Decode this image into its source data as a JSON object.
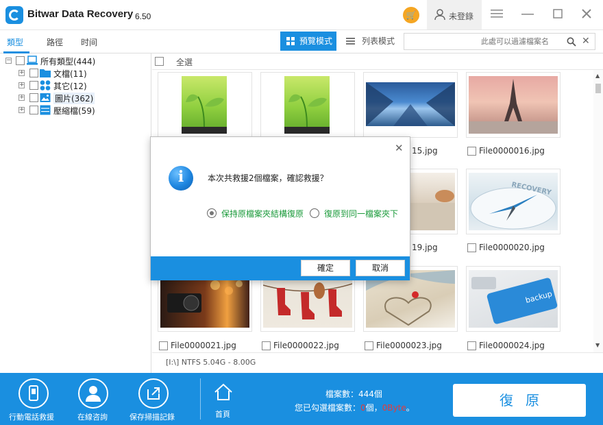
{
  "app": {
    "title": "Bitwar Data Recovery",
    "version": "6.50",
    "user_label": "未登錄",
    "icons": [
      "cart-icon",
      "user-icon",
      "menu-icon",
      "minimize-icon",
      "maximize-icon",
      "close-icon"
    ]
  },
  "tabs": [
    {
      "label": "類型",
      "active": true
    },
    {
      "label": "路徑",
      "active": false
    },
    {
      "label": "时间",
      "active": false
    }
  ],
  "view": {
    "preview_label": "預覽模式",
    "list_label": "列表模式"
  },
  "search": {
    "placeholder": "此處可以過濾檔案名"
  },
  "tree": {
    "root": "所有類型(444)",
    "items": [
      {
        "label": "文檔(11)",
        "icon": "folder-icon"
      },
      {
        "label": "其它(12)",
        "icon": "apps-icon"
      },
      {
        "label": "圖片(362)",
        "icon": "picture-icon"
      },
      {
        "label": "壓縮檔(59)",
        "icon": "archive-icon"
      }
    ]
  },
  "content": {
    "select_all": "全選",
    "files": [
      {
        "name": "",
        "image": "sprout"
      },
      {
        "name": "",
        "image": "sprout"
      },
      {
        "name": "15.jpg",
        "image": "sky"
      },
      {
        "name": "File0000016.jpg",
        "image": "paris"
      },
      {
        "name": "19.jpg",
        "image": "cat"
      },
      {
        "name": "File0000020.jpg",
        "image": "compass"
      },
      {
        "name": "File0000021.jpg",
        "image": "camera"
      },
      {
        "name": "File0000022.jpg",
        "image": "socks"
      },
      {
        "name": "File0000023.jpg",
        "image": "beach"
      },
      {
        "name": "File0000024.jpg",
        "image": "key"
      }
    ],
    "status": "[I:\\] NTFS 5.04G - 8.00G"
  },
  "bottom": {
    "mobile_label": "行動電話救援",
    "consult_label": "在線咨詢",
    "save_label": "保存掃描記錄",
    "home_label": "首頁",
    "file_count_label": "檔案數：444個",
    "selected_prefix": "您已勾選檔案數：",
    "selected_count": "0",
    "selected_mid": "個，",
    "selected_size": "0Byte",
    "selected_suffix": "。",
    "recover_label": "復原"
  },
  "dialog": {
    "message": "本次共救援2個檔案，確認救援？",
    "option1": "保持原檔案夾結構復原",
    "option2": "復原到同一檔案夾下",
    "selected_option": 1,
    "ok_label": "確定",
    "cancel_label": "取消"
  },
  "colors": {
    "accent": "#1a8fe0",
    "cart": "#f5a623",
    "option_text": "#1a9a3a",
    "highlight_red": "#e63a3a"
  }
}
